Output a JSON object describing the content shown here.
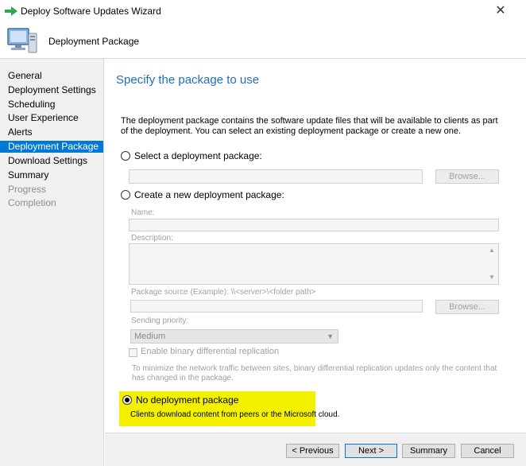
{
  "window": {
    "title": "Deploy Software Updates Wizard",
    "close_glyph": "✕"
  },
  "header": {
    "page_name": "Deployment Package"
  },
  "sidebar": {
    "items": [
      {
        "label": "General",
        "state": "normal"
      },
      {
        "label": "Deployment Settings",
        "state": "normal"
      },
      {
        "label": "Scheduling",
        "state": "normal"
      },
      {
        "label": "User Experience",
        "state": "normal"
      },
      {
        "label": "Alerts",
        "state": "normal"
      },
      {
        "label": "Deployment Package",
        "state": "active"
      },
      {
        "label": "Download Settings",
        "state": "normal"
      },
      {
        "label": "Summary",
        "state": "normal"
      },
      {
        "label": "Progress",
        "state": "disabled"
      },
      {
        "label": "Completion",
        "state": "disabled"
      }
    ]
  },
  "main": {
    "heading": "Specify the package to use",
    "description": "The deployment package contains the software update files that will be available to clients as part of the deployment. You can select an existing deployment package or create a new one.",
    "option_select": "Select a deployment package:",
    "browse_label": "Browse...",
    "option_create": "Create a new deployment package:",
    "name_label": "Name:",
    "description_label": "Description:",
    "package_source_label": "Package source (Example): \\\\<server>\\<folder path>",
    "sending_priority_label": "Sending priority:",
    "sending_priority_value": "Medium",
    "binary_diff_label": "Enable binary differential replication",
    "binary_diff_note": "To minimize the network traffic between sites, binary differential replication updates only the content that has changed in the package.",
    "option_none": "No deployment package",
    "option_none_sub": "Clients download content from peers or the Microsoft cloud."
  },
  "footer": {
    "previous": "< Previous",
    "next": "Next >",
    "summary": "Summary",
    "cancel": "Cancel"
  },
  "colors": {
    "accent": "#0078d7",
    "heading": "#1d6fbd",
    "highlight": "#f3f000"
  }
}
